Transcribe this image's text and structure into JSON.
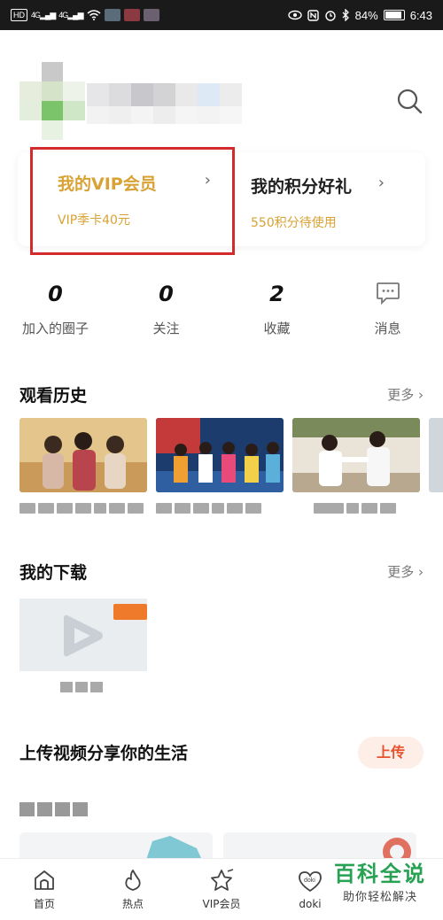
{
  "status_bar": {
    "network_badge": "HD",
    "signal_1": "4G",
    "signal_2": "4G",
    "battery": "84%",
    "time": "6:43"
  },
  "header": {
    "search_icon": "search-icon"
  },
  "vip": {
    "title": "我的VIP会员",
    "subtitle": "VIP季卡40元",
    "chevron": "›"
  },
  "points": {
    "title": "我的积分好礼",
    "subtitle": "550积分待使用",
    "chevron": "›"
  },
  "stats": [
    {
      "value": "0",
      "label": "加入的圈子"
    },
    {
      "value": "0",
      "label": "关注"
    },
    {
      "value": "2",
      "label": "收藏"
    },
    {
      "icon": "message-icon",
      "label": "消息"
    }
  ],
  "history": {
    "title": "观看历史",
    "more": "更多 ›"
  },
  "downloads": {
    "title": "我的下载",
    "more": "更多 ›"
  },
  "upload": {
    "title": "上传视频分享你的生活",
    "button": "上传"
  },
  "nav": [
    {
      "label": "首页",
      "icon": "home-icon"
    },
    {
      "label": "热点",
      "icon": "flame-icon"
    },
    {
      "label": "VIP会员",
      "icon": "vip-star-icon"
    },
    {
      "label": "doki",
      "icon": "doki-heart-icon"
    }
  ],
  "watermark": {
    "main": "百科全说",
    "sub": "助你轻松解决"
  },
  "colors": {
    "gold": "#d8a234",
    "highlight_border": "#d32b2b",
    "upload_accent": "#e8512c",
    "watermark_green": "#27a152"
  }
}
